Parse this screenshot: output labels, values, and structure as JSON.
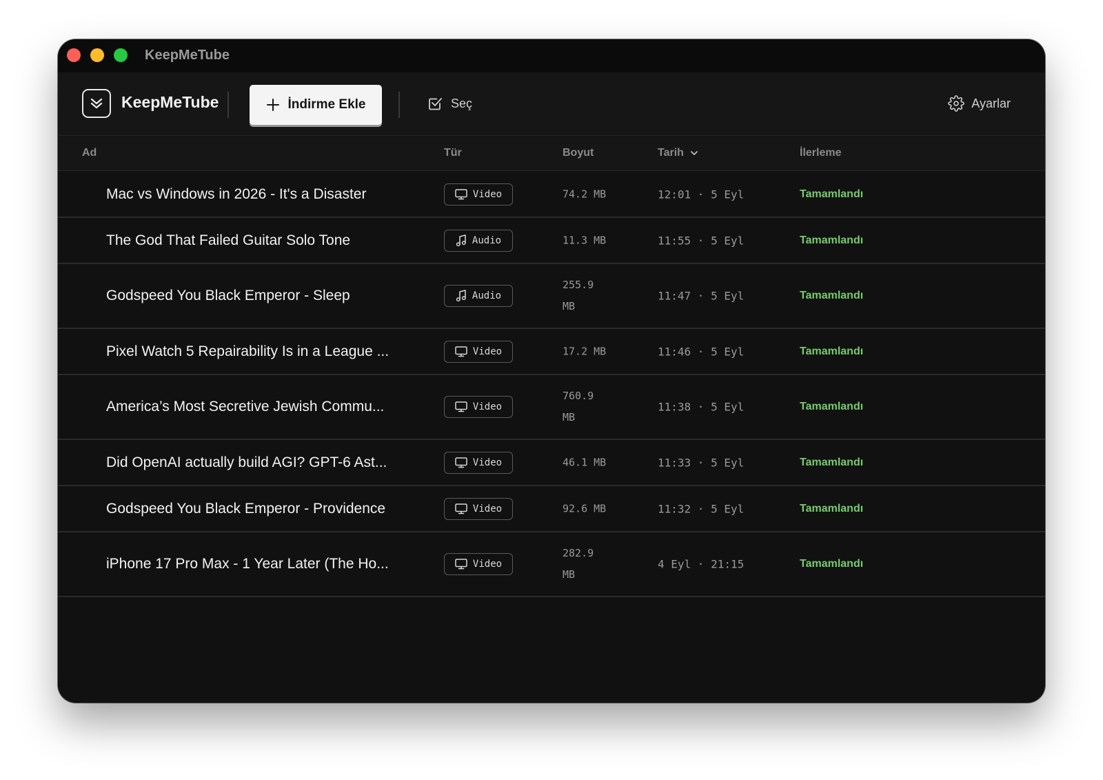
{
  "window": {
    "title": "KeepMeTube"
  },
  "toolbar": {
    "brand": "KeepMeTube",
    "add_download_label": "İndirme Ekle",
    "select_label": "Seç",
    "settings_label": "Ayarlar"
  },
  "table": {
    "columns": {
      "name": "Ad",
      "type": "Tür",
      "size": "Boyut",
      "date": "Tarih",
      "progress": "İlerleme"
    },
    "rows": [
      {
        "name": "Mac vs Windows in 2026 - It's a Disaster",
        "type": "Video",
        "icon": "monitor-icon",
        "size": "74.2 MB",
        "date": "12:01 · 5 Eyl",
        "status": "Tamamlandı"
      },
      {
        "name": "The God That Failed Guitar Solo Tone",
        "type": "Audio",
        "icon": "music-note-icon",
        "size": "11.3 MB",
        "date": "11:55 · 5 Eyl",
        "status": "Tamamlandı"
      },
      {
        "name": "Godspeed You Black Emperor - Sleep",
        "type": "Audio",
        "icon": "music-note-icon",
        "size": "255.9 MB",
        "date": "11:47 · 5 Eyl",
        "status": "Tamamlandı"
      },
      {
        "name": "Pixel Watch 5 Repairability Is in a League ...",
        "type": "Video",
        "icon": "monitor-icon",
        "size": "17.2 MB",
        "date": "11:46 · 5 Eyl",
        "status": "Tamamlandı"
      },
      {
        "name": "America’s Most Secretive Jewish Commu...",
        "type": "Video",
        "icon": "monitor-icon",
        "size": "760.9 MB",
        "date": "11:38 · 5 Eyl",
        "status": "Tamamlandı"
      },
      {
        "name": "Did OpenAI actually build AGI? GPT-6 Ast...",
        "type": "Video",
        "icon": "monitor-icon",
        "size": "46.1 MB",
        "date": "11:33 · 5 Eyl",
        "status": "Tamamlandı"
      },
      {
        "name": "Godspeed You Black Emperor - Providence",
        "type": "Video",
        "icon": "monitor-icon",
        "size": "92.6 MB",
        "date": "11:32 · 5 Eyl",
        "status": "Tamamlandı"
      },
      {
        "name": "iPhone 17 Pro Max - 1 Year Later (The Ho...",
        "type": "Video",
        "icon": "monitor-icon",
        "size": "282.9 MB",
        "date": "4 Eyl · 21:15",
        "status": "Tamamlandı"
      }
    ]
  },
  "colors": {
    "background": "#111111",
    "toolbar": "#161616",
    "accent_success": "#77cc6e",
    "button_bg": "#f4f4f4"
  }
}
